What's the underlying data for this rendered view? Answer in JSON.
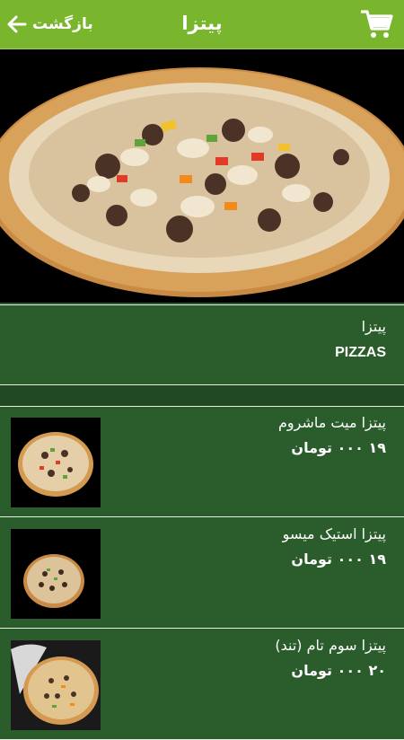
{
  "header": {
    "back_label": "بازگشت",
    "title": "پیتزا",
    "icons": {
      "back": "arrow-left-icon",
      "cart": "cart-icon"
    },
    "colors": {
      "bar": "#7ab52e",
      "background": "#2b5c2c"
    }
  },
  "category": {
    "name_fa": "پیتزا",
    "name_en": "PIZZAS"
  },
  "items": [
    {
      "name": "پیتزا میت ماشروم",
      "price": "۱۹ ۰۰۰",
      "currency": "تومان"
    },
    {
      "name": "پیتزا استیک میسو",
      "price": "۱۹ ۰۰۰",
      "currency": "تومان"
    },
    {
      "name": "پیتزا سوم تام (تند)",
      "price": "۲۰ ۰۰۰",
      "currency": "تومان"
    }
  ]
}
